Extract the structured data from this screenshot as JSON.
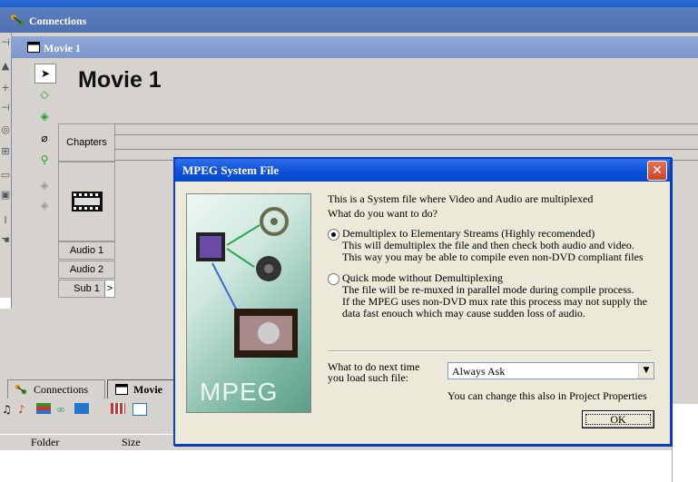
{
  "connections_window": {
    "title": "Connections"
  },
  "movie_window": {
    "title": "Movie 1",
    "heading": "Movie 1",
    "tracks": {
      "chapters": "Chapters",
      "audio1": "Audio 1",
      "audio2": "Audio 2",
      "sub1": "Sub 1",
      "sub1_arrow": ">"
    }
  },
  "bottom_panel": {
    "tabs": [
      "Connections",
      "Movie"
    ],
    "columns": [
      "Folder",
      "Size"
    ]
  },
  "dialog": {
    "title": "MPEG System File",
    "close_glyph": "✕",
    "image_caption": "MPEG",
    "intro_line1": "This is a System file where Video and Audio are multiplexed",
    "intro_line2": "What do you want to do?",
    "options": [
      {
        "label": "Demultiplex to Elementary Streams (Highly recomended)",
        "desc1": "This will demultiplex the file and then check both audio and video.",
        "desc2": "This way you may be able to compile even non-DVD compliant files",
        "selected": true
      },
      {
        "label": "Quick mode without Demultiplexing",
        "desc1": "The file will be re-muxed in parallel mode during compile process.",
        "desc2": "If the MPEG uses non-DVD mux rate this process may not supply the",
        "desc3": "data fast enouch which may cause sudden loss of audio.",
        "selected": false
      }
    ],
    "next_time_label_line1": "What to do next time",
    "next_time_label_line2": "you load such file:",
    "next_time_value": "Always Ask",
    "hint": "You can change this also in Project Properties",
    "ok_label": "OK"
  },
  "colors": {
    "dialog_title": "#0b4fd8",
    "close_button": "#c8452a",
    "window_face": "#d6d3ce"
  }
}
